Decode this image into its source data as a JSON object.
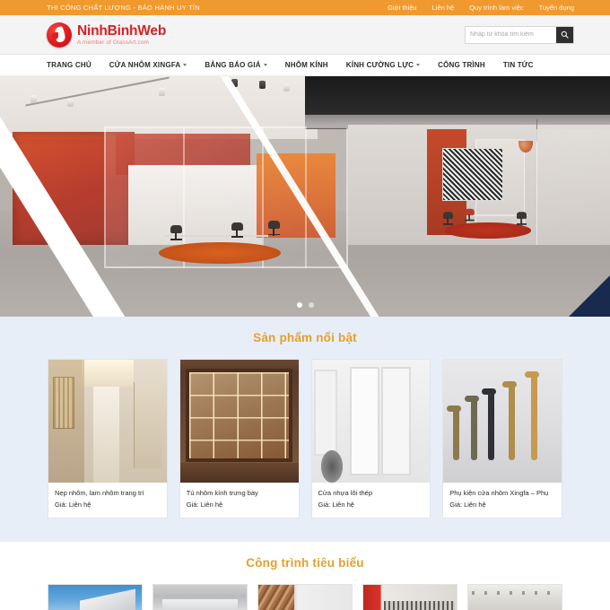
{
  "topbar": {
    "slogan": "THI CÔNG CHẤT LƯỢNG - BẢO HÀNH UY TÍN",
    "links": [
      {
        "label": "Giới thiệu"
      },
      {
        "label": "Liên hệ"
      },
      {
        "label": "Quy trình làm việc"
      },
      {
        "label": "Tuyển dụng"
      }
    ],
    "bg_color": "#f0992e"
  },
  "header": {
    "logo_name": "NinhBinhWeb",
    "logo_tagline": "A member of GlassArt.com",
    "logo_icon": "flame-circle-logo",
    "logo_color": "#d62125",
    "search": {
      "placeholder": "Nhập từ khóa tìm kiếm",
      "value": "",
      "button_icon": "search-icon"
    }
  },
  "nav": {
    "items": [
      {
        "label": "TRANG CHỦ",
        "has_dropdown": false
      },
      {
        "label": "CỬA NHÔM XINGFA",
        "has_dropdown": true
      },
      {
        "label": "BẢNG BÁO GIÁ",
        "has_dropdown": true
      },
      {
        "label": "NHÔM KÍNH",
        "has_dropdown": false
      },
      {
        "label": "KÍNH CƯỜNG LỰC",
        "has_dropdown": true
      },
      {
        "label": "CÔNG TRÌNH",
        "has_dropdown": false
      },
      {
        "label": "TIN TỨC",
        "has_dropdown": false
      }
    ]
  },
  "hero": {
    "alt": "Văn phòng vách kính khung nhôm màu cam đỏ",
    "slides": 2,
    "active_slide": 1
  },
  "products_section": {
    "title": "Sản phẩm nổi bật",
    "title_color": "#e3a02f",
    "bg_color": "#e7eef7",
    "items": [
      {
        "name": "Nẹp nhôm, lam nhôm trang trí",
        "price": "Giá: Liên hệ",
        "image": "corridor-interior"
      },
      {
        "name": "Tủ nhôm kính trưng bày",
        "price": "Giá: Liên hệ",
        "image": "glass-display-cabinet"
      },
      {
        "name": "Cửa nhựa lõi thép",
        "price": "Giá: Liên hệ",
        "image": "white-french-doors"
      },
      {
        "name": "Phụ kiện cửa nhôm Xingfa – Phụ",
        "price": "Giá: Liên hệ",
        "image": "window-handles"
      }
    ]
  },
  "projects_section": {
    "title": "Công trình tiêu biểu",
    "title_color": "#e3a02f",
    "items": [
      {
        "image": "roof-blue-sky"
      },
      {
        "image": "kitchen-counter"
      },
      {
        "image": "stone-wall-railing"
      },
      {
        "image": "red-banner-aluminium"
      },
      {
        "image": "aluminium-profiles"
      }
    ]
  }
}
